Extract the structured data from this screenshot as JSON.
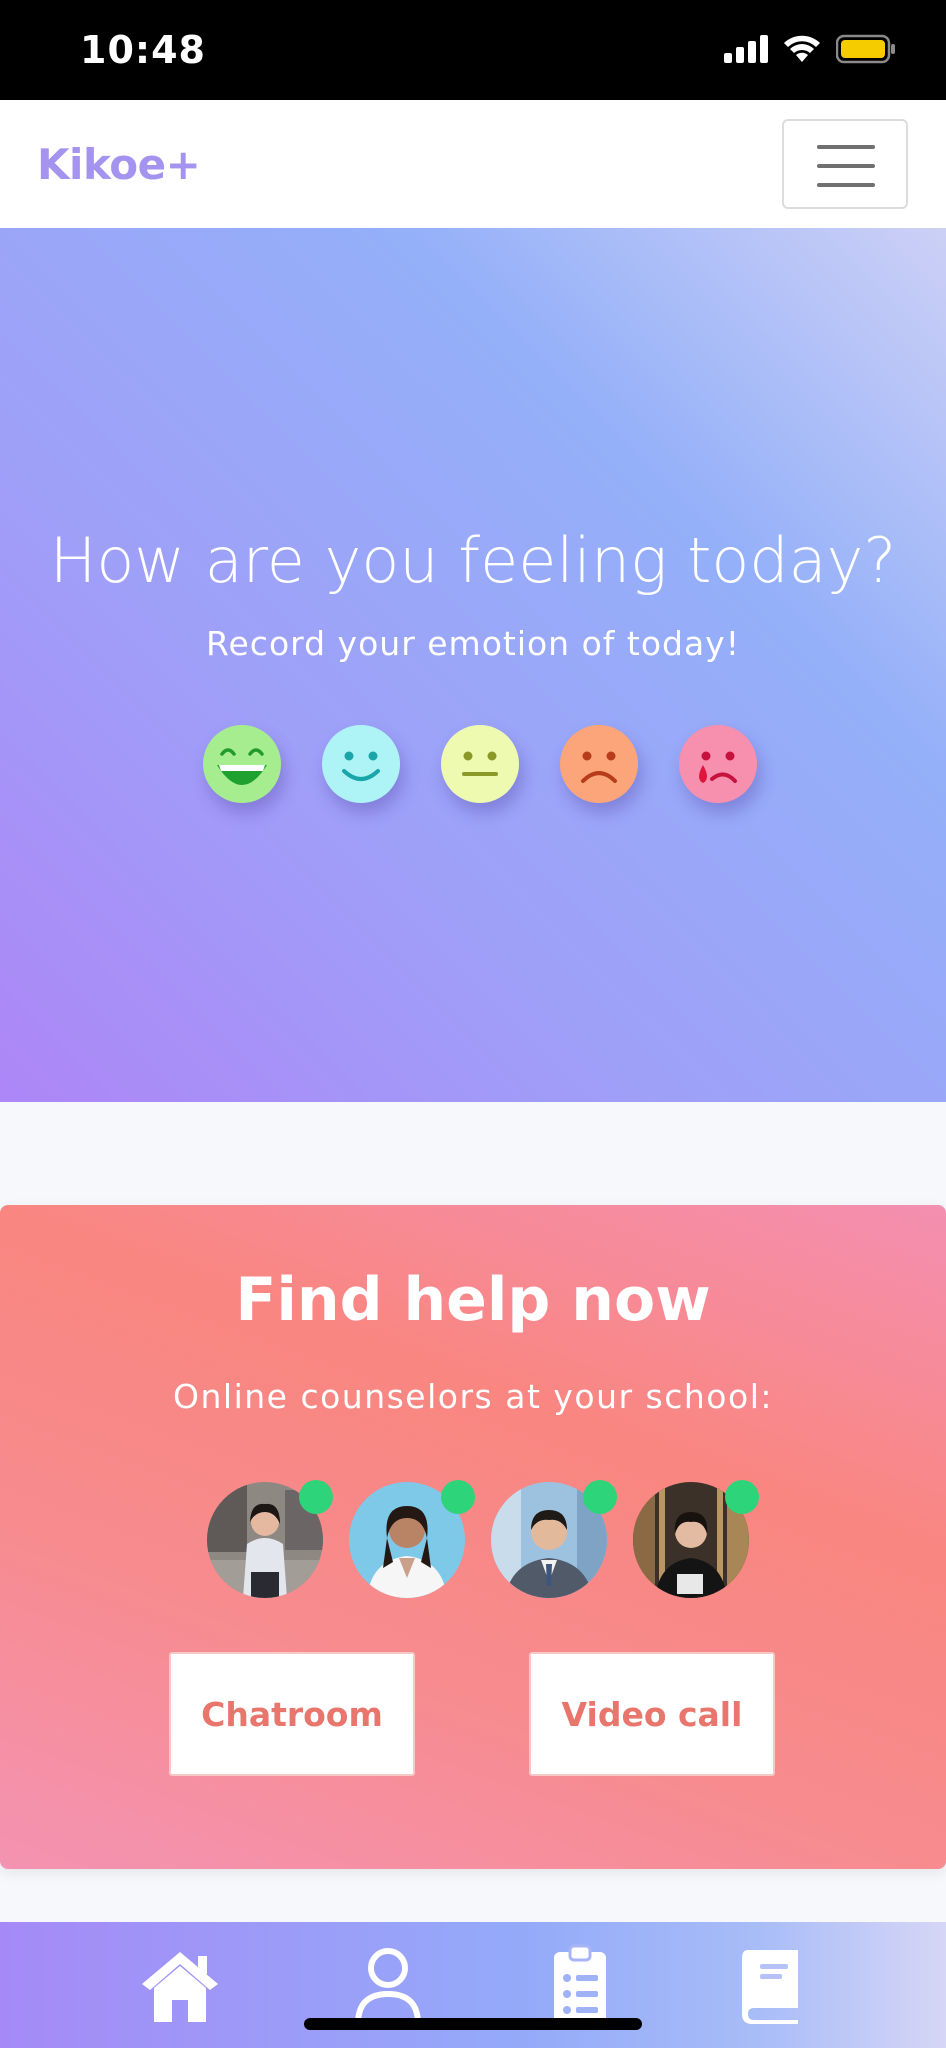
{
  "status_bar": {
    "time": "10:48"
  },
  "navbar": {
    "brand": "Kikoe+"
  },
  "hero": {
    "title": "How are you feeling today?",
    "subtitle": "Record your emotion of today!",
    "emotions": [
      "very-happy",
      "happy",
      "neutral",
      "sad",
      "crying"
    ]
  },
  "help": {
    "title": "Find help now",
    "subtitle": "Online counselors at your school:",
    "counselors_online": 4,
    "chatroom_label": "Chatroom",
    "video_call_label": "Video call"
  },
  "tabbar": {
    "items": [
      "home-icon",
      "profile-icon",
      "clipboard-list-icon",
      "book-icon"
    ]
  },
  "colors": {
    "brand": "#a593f0",
    "online": "#2ed47a",
    "button_text": "#e8766d"
  }
}
